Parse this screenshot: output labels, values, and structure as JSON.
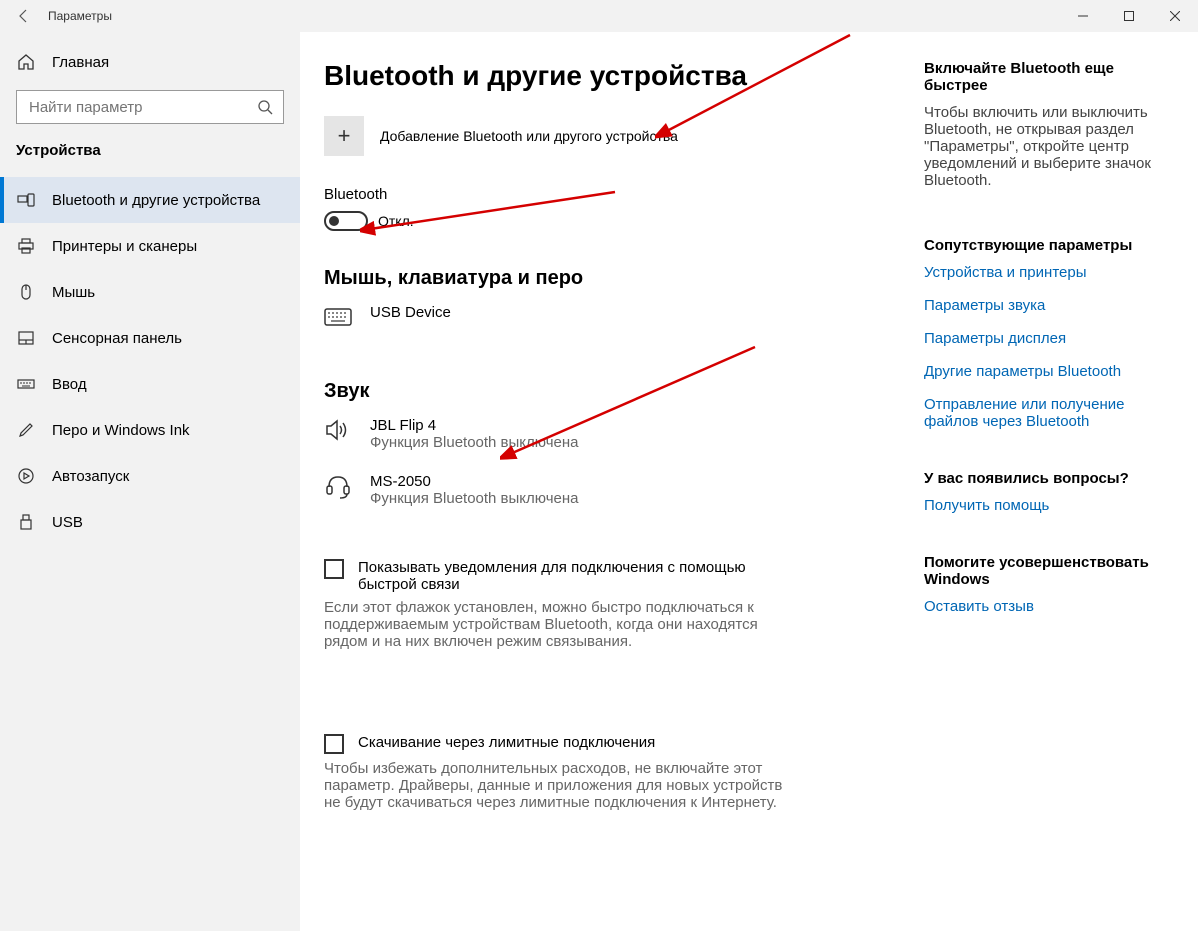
{
  "titlebar": {
    "title": "Параметры"
  },
  "sidebar": {
    "home": "Главная",
    "search_placeholder": "Найти параметр",
    "section": "Устройства",
    "items": [
      {
        "label": "Bluetooth и другие устройства",
        "active": true
      },
      {
        "label": "Принтеры и сканеры"
      },
      {
        "label": "Мышь"
      },
      {
        "label": "Сенсорная панель"
      },
      {
        "label": "Ввод"
      },
      {
        "label": "Перо и Windows Ink"
      },
      {
        "label": "Автозапуск"
      },
      {
        "label": "USB"
      }
    ]
  },
  "main": {
    "title": "Bluetooth и другие устройства",
    "add_device": "Добавление Bluetooth или другого устройства",
    "bluetooth_label": "Bluetooth",
    "bluetooth_state": "Откл.",
    "group_mouse": "Мышь, клавиатура и перо",
    "device_usb": "USB Device",
    "group_sound": "Звук",
    "device_jbl": {
      "name": "JBL Flip 4",
      "status": "Функция Bluetooth выключена"
    },
    "device_ms": {
      "name": "MS-2050",
      "status": "Функция Bluetooth выключена"
    },
    "check1_label": "Показывать уведомления для подключения с помощью быстрой связи",
    "check1_desc": "Если этот флажок установлен, можно быстро подключаться к поддерживаемым устройствам Bluetooth, когда они находятся рядом и на них включен режим связывания.",
    "check2_label": "Скачивание через лимитные подключения",
    "check2_desc": "Чтобы избежать дополнительных расходов, не включайте этот параметр. Драйверы, данные и приложения для новых устройств не будут скачиваться через лимитные подключения к Интернету."
  },
  "aside": {
    "tip_title": "Включайте Bluetooth еще быстрее",
    "tip_text": "Чтобы включить или выключить Bluetooth, не открывая раздел \"Параметры\", откройте центр уведомлений и выберите значок Bluetooth.",
    "related_title": "Сопутствующие параметры",
    "links": [
      "Устройства и принтеры",
      "Параметры звука",
      "Параметры дисплея",
      "Другие параметры Bluetooth",
      "Отправление или получение файлов через Bluetooth"
    ],
    "help_title": "У вас появились вопросы?",
    "help_link": "Получить помощь",
    "feedback_title": "Помогите усовершенствовать Windows",
    "feedback_link": "Оставить отзыв"
  }
}
